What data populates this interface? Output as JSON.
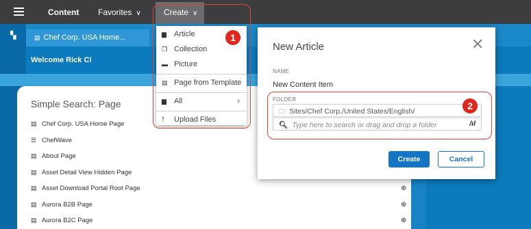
{
  "topbar": {
    "content_label": "Content",
    "favorites_label": "Favorites",
    "create_label": "Create",
    "chevron": "∨"
  },
  "app": {
    "home_tab": "Chef Corp. USA Home...",
    "welcome": "Welcome Rick C!",
    "panel_title": "Simple Search: Page",
    "rows": [
      {
        "icon": "page-icon",
        "label": "Chef Corp. USA Home Page",
        "globe": false
      },
      {
        "icon": "list-icon",
        "label": "ChefWave",
        "globe": false
      },
      {
        "icon": "page-icon",
        "label": "About Page",
        "globe": false
      },
      {
        "icon": "page-icon",
        "label": "Asset Detail View Hidden Page",
        "globe": false
      },
      {
        "icon": "page-icon",
        "label": "Asset Download Portal Root Page",
        "globe": true
      },
      {
        "icon": "page-icon",
        "label": "Aurora B2B Page",
        "globe": true
      },
      {
        "icon": "page-icon",
        "label": "Aurora B2C Page",
        "globe": true
      }
    ]
  },
  "dropdown": {
    "items": [
      {
        "label": "Article",
        "icon": "article-icon"
      },
      {
        "label": "Collection",
        "icon": "collection-icon"
      },
      {
        "label": "Picture",
        "icon": "picture-icon"
      },
      {
        "label": "Page from Template",
        "icon": "template-icon"
      },
      {
        "label": "All",
        "icon": "all-icon",
        "arrow": "›"
      },
      {
        "label": "Upload Files",
        "icon": "upload-icon"
      }
    ]
  },
  "modal": {
    "title": "New Article",
    "close": "✕",
    "name_label": "NAME",
    "name_value": "New Content Item",
    "folder_label": "FOLDER",
    "folder_path": "Sites/Chef Corp./United States/English/",
    "search_placeholder": "Type here to search or drag and drop a folder",
    "create_button": "Create",
    "cancel_button": "Cancel"
  },
  "callouts": {
    "one": "1",
    "two": "2"
  },
  "colors": {
    "topbar": "#3d3d3f",
    "accent_blue": "#1574c4",
    "callout_red": "#e0271e"
  }
}
